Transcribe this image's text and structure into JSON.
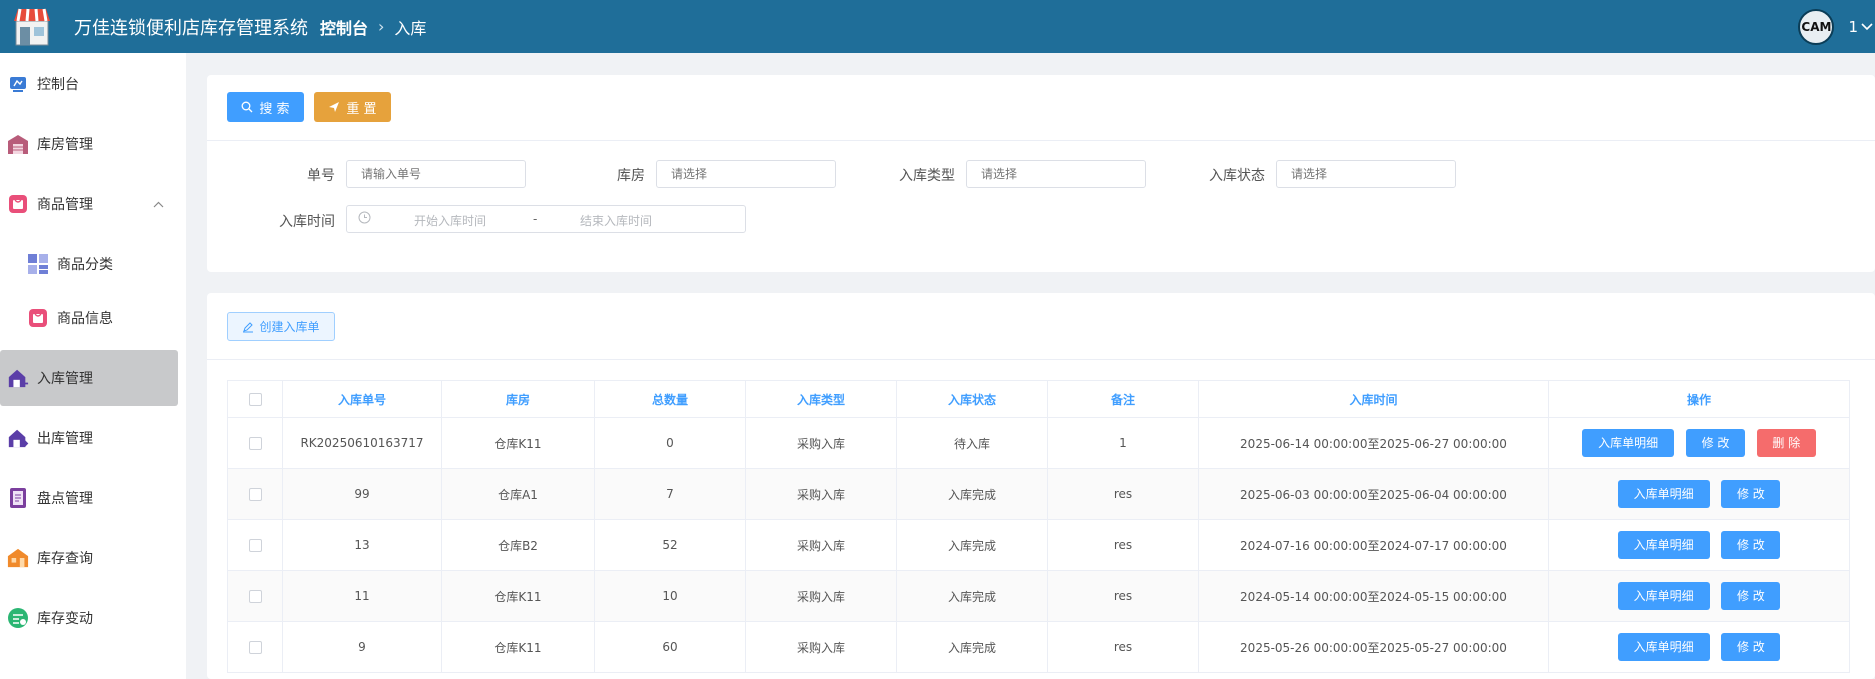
{
  "header": {
    "app_title": "万佳连锁便利店库存管理系统",
    "breadcrumb_home": "控制台",
    "breadcrumb_sep": "›",
    "breadcrumb_page": "入库",
    "avatar_text": "CAM",
    "user_label": "1",
    "user_menu_icon": "chevron-down-icon"
  },
  "sidebar": {
    "items": [
      {
        "label": "控制台",
        "icon": "dashboard-icon"
      },
      {
        "label": "库房管理",
        "icon": "warehouse-icon"
      },
      {
        "label": "商品管理",
        "icon": "goods-icon",
        "expanded": true
      },
      {
        "label": "商品分类",
        "icon": "category-icon"
      },
      {
        "label": "商品信息",
        "icon": "goods-info-icon"
      },
      {
        "label": "入库管理",
        "icon": "inbound-icon",
        "active": true
      },
      {
        "label": "出库管理",
        "icon": "outbound-icon"
      },
      {
        "label": "盘点管理",
        "icon": "inventory-check-icon"
      },
      {
        "label": "库存查询",
        "icon": "stock-query-icon"
      },
      {
        "label": "库存变动",
        "icon": "stock-change-icon"
      }
    ]
  },
  "search": {
    "search_button": "搜 索",
    "reset_button": "重 置",
    "order_no_label": "单号",
    "order_no_placeholder": "请输入单号",
    "warehouse_label": "库房",
    "warehouse_placeholder": "请选择",
    "type_label": "入库类型",
    "type_placeholder": "请选择",
    "status_label": "入库状态",
    "status_placeholder": "请选择",
    "time_label": "入库时间",
    "start_placeholder": "开始入库时间",
    "range_sep": "-",
    "end_placeholder": "结束入库时间"
  },
  "table": {
    "create_button": "创建入库单",
    "columns": [
      "入库单号",
      "库房",
      "总数量",
      "入库类型",
      "入库状态",
      "备注",
      "入库时间",
      "操作"
    ],
    "detail_label": "入库单明细",
    "edit_label": "修 改",
    "delete_label": "删 除",
    "rows": [
      {
        "no": "RK20250610163717",
        "warehouse": "仓库K11",
        "qty": "0",
        "type": "采购入库",
        "status": "待入库",
        "remark": "1",
        "time": "2025-06-14 00:00:00至2025-06-27 00:00:00",
        "deletable": true
      },
      {
        "no": "99",
        "warehouse": "仓库A1",
        "qty": "7",
        "type": "采购入库",
        "status": "入库完成",
        "remark": "res",
        "time": "2025-06-03 00:00:00至2025-06-04 00:00:00",
        "deletable": false
      },
      {
        "no": "13",
        "warehouse": "仓库B2",
        "qty": "52",
        "type": "采购入库",
        "status": "入库完成",
        "remark": "res",
        "time": "2024-07-16 00:00:00至2024-07-17 00:00:00",
        "deletable": false
      },
      {
        "no": "11",
        "warehouse": "仓库K11",
        "qty": "10",
        "type": "采购入库",
        "status": "入库完成",
        "remark": "res",
        "time": "2024-05-14 00:00:00至2024-05-15 00:00:00",
        "deletable": false
      },
      {
        "no": "9",
        "warehouse": "仓库K11",
        "qty": "60",
        "type": "采购入库",
        "status": "入库完成",
        "remark": "res",
        "time": "2025-05-26 00:00:00至2025-05-27 00:00:00",
        "deletable": false
      }
    ]
  },
  "colors": {
    "header_bg": "#1f6e99",
    "primary": "#409eff",
    "warning": "#e6a23c",
    "danger": "#f56c6c"
  }
}
